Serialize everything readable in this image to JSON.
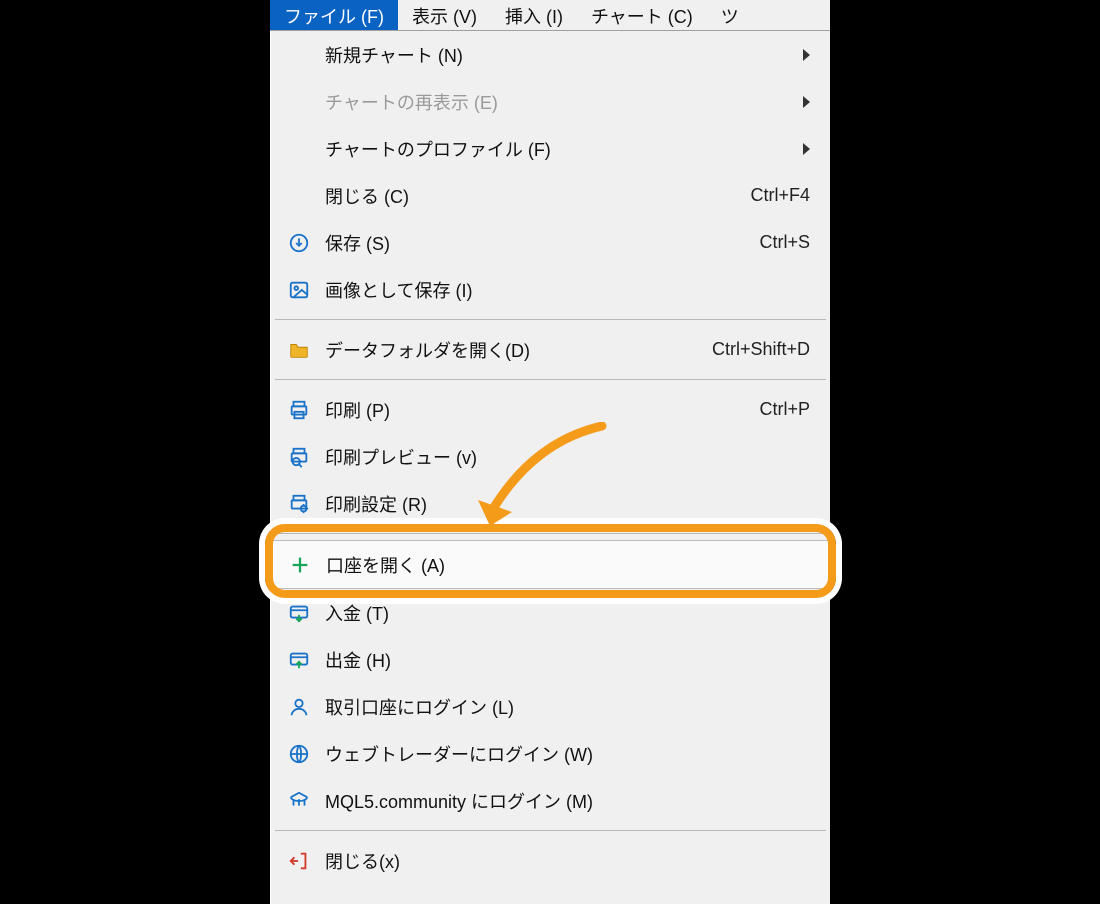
{
  "menubar": {
    "items": [
      {
        "label": "ファイル (F)",
        "active": true
      },
      {
        "label": "表示 (V)"
      },
      {
        "label": "挿入 (I)"
      },
      {
        "label": "チャート (C)"
      },
      {
        "label": "ツ"
      }
    ]
  },
  "menu": {
    "groups": [
      [
        {
          "icon": "",
          "label": "新規チャート (N)",
          "submenu": true
        },
        {
          "icon": "",
          "label": "チャートの再表示 (E)",
          "submenu": true,
          "disabled": true
        },
        {
          "icon": "",
          "label": "チャートのプロファイル (F)",
          "submenu": true
        },
        {
          "icon": "",
          "label": "閉じる (C)",
          "shortcut": "Ctrl+F4"
        },
        {
          "icon": "save",
          "label": "保存 (S)",
          "shortcut": "Ctrl+S"
        },
        {
          "icon": "image",
          "label": "画像として保存 (I)"
        }
      ],
      [
        {
          "icon": "folder",
          "label": "データフォルダを開く(D)",
          "shortcut": "Ctrl+Shift+D"
        }
      ],
      [
        {
          "icon": "print",
          "label": "印刷 (P)",
          "shortcut": "Ctrl+P"
        },
        {
          "icon": "preview",
          "label": "印刷プレビュー (v)"
        },
        {
          "icon": "print-gear",
          "label": "印刷設定 (R)"
        }
      ],
      [
        {
          "icon": "plus",
          "label": "口座を開く (A)",
          "highlight": true
        },
        {
          "icon": "deposit",
          "label": "入金 (T)"
        },
        {
          "icon": "withdraw",
          "label": "出金 (H)"
        },
        {
          "icon": "user",
          "label": "取引口座にログイン (L)"
        },
        {
          "icon": "globe",
          "label": "ウェブトレーダーにログイン (W)"
        },
        {
          "icon": "mql5",
          "label": "MQL5.community にログイン (M)"
        }
      ],
      [
        {
          "icon": "exit",
          "label": "閉じる(x)"
        }
      ]
    ]
  }
}
